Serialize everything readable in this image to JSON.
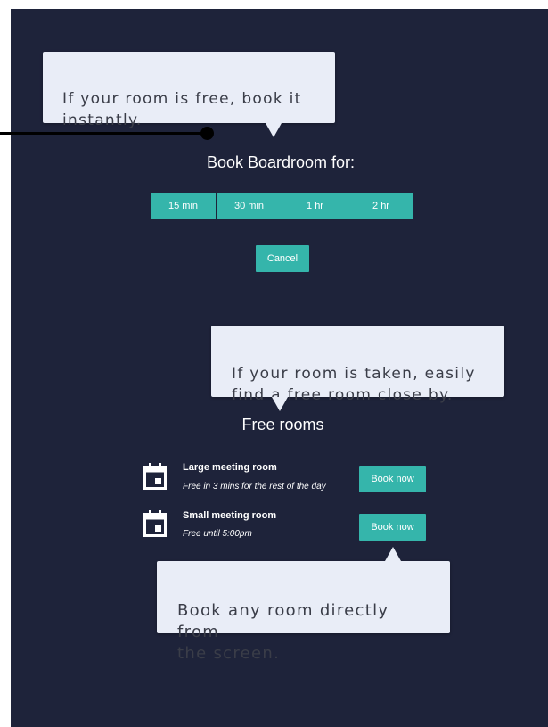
{
  "tips": {
    "instant_book": "If your room is free, book it\ninstantly.",
    "find_free": "If your room is taken, easily\nfind a free room close by.",
    "book_any": "Book any room directly from\nthe screen."
  },
  "booking": {
    "heading": "Book Boardroom for:",
    "durations": [
      "15 min",
      "30 min",
      "1 hr",
      "2 hr"
    ],
    "cancel_label": "Cancel"
  },
  "free_rooms": {
    "heading": "Free rooms",
    "rooms": [
      {
        "name": "Large meeting room",
        "status": "Free in 3 mins for the rest of the day",
        "action": "Book now",
        "icon": "calendar-icon"
      },
      {
        "name": "Small meeting room",
        "status": "Free until 5:00pm",
        "action": "Book now",
        "icon": "calendar-icon"
      }
    ]
  },
  "colors": {
    "background": "#1e233a",
    "accent": "#35b5ab",
    "bubble": "#e9edf7"
  }
}
